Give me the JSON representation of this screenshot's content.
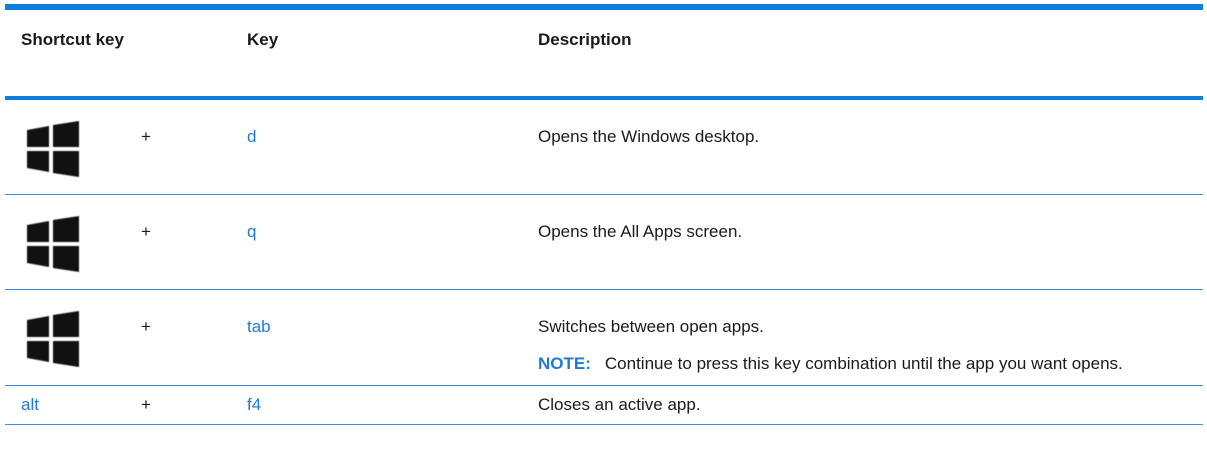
{
  "header": {
    "shortcut_key": "Shortcut key",
    "key": "Key",
    "description": "Description"
  },
  "rows": [
    {
      "shortcut": "windows-key",
      "plus": "+",
      "key": "d",
      "description": "Opens the Windows desktop."
    },
    {
      "shortcut": "windows-key",
      "plus": "+",
      "key": "q",
      "description": "Opens the All Apps screen."
    },
    {
      "shortcut": "windows-key",
      "plus": "+",
      "key": "tab",
      "description": "Switches between open apps.",
      "note_label": "NOTE:",
      "note_text": "Continue to press this key combination until the app you want opens."
    },
    {
      "shortcut": "alt",
      "plus": "+",
      "key": "f4",
      "description": "Closes an active app."
    }
  ],
  "colors": {
    "accent_blue": "#0a7fe0",
    "link_blue": "#1e7ad6",
    "text": "#1a1a1a"
  }
}
